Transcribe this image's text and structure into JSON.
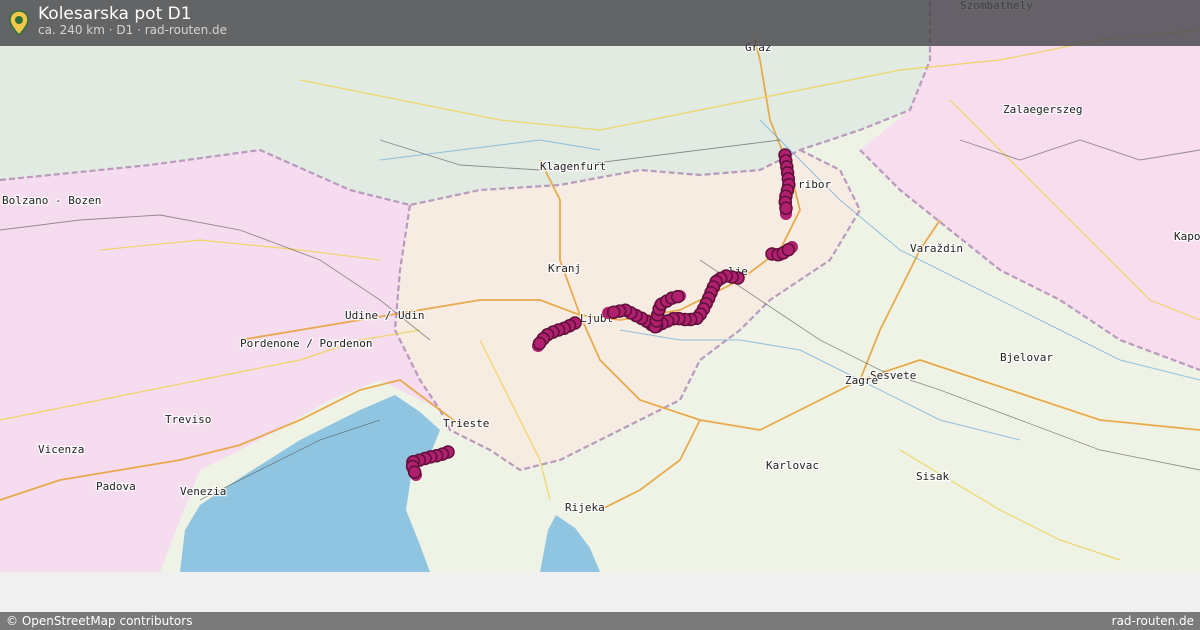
{
  "header": {
    "title": "Kolesarska pot D1",
    "subtitle": "ca. 240 km · D1 · rad-routen.de",
    "pin_icon": "map-pin-icon"
  },
  "map": {
    "colors": {
      "sea": "#8fc5e0",
      "route": "#b0206e",
      "route_dark": "#5e0f3a",
      "slovenia": "#f6ece2",
      "croatia": "#eef3e6",
      "austria": "#e2ebe2",
      "italy": "#f6dcef",
      "hungary": "#f7ddee"
    },
    "labels": [
      {
        "name": "Szombathely"
      },
      {
        "name": "Graz"
      },
      {
        "name": "Zalaegerszeg"
      },
      {
        "name": "Klagenfurt"
      },
      {
        "name": "Maribor",
        "shown": "ribor"
      },
      {
        "name": "Bolzano - Bozen"
      },
      {
        "name": "Kaposvár",
        "shown": "Kapos"
      },
      {
        "name": "Varaždin"
      },
      {
        "name": "Kranj"
      },
      {
        "name": "Celje",
        "shown": "lje"
      },
      {
        "name": "Ljubljana",
        "shown": "Ljubl"
      },
      {
        "name": "Udine / Udin"
      },
      {
        "name": "Pordenone / Pordenon"
      },
      {
        "name": "Bjelovar"
      },
      {
        "name": "Sesvete"
      },
      {
        "name": "Zagreb",
        "shown": "Zagre"
      },
      {
        "name": "Treviso"
      },
      {
        "name": "Trieste"
      },
      {
        "name": "Vicenza"
      },
      {
        "name": "Karlovac"
      },
      {
        "name": "Sisak"
      },
      {
        "name": "Padova"
      },
      {
        "name": "Venezia"
      },
      {
        "name": "Rijeka"
      }
    ]
  },
  "footer": {
    "attribution": "© OpenStreetMap contributors",
    "brand": "rad-routen.de"
  }
}
